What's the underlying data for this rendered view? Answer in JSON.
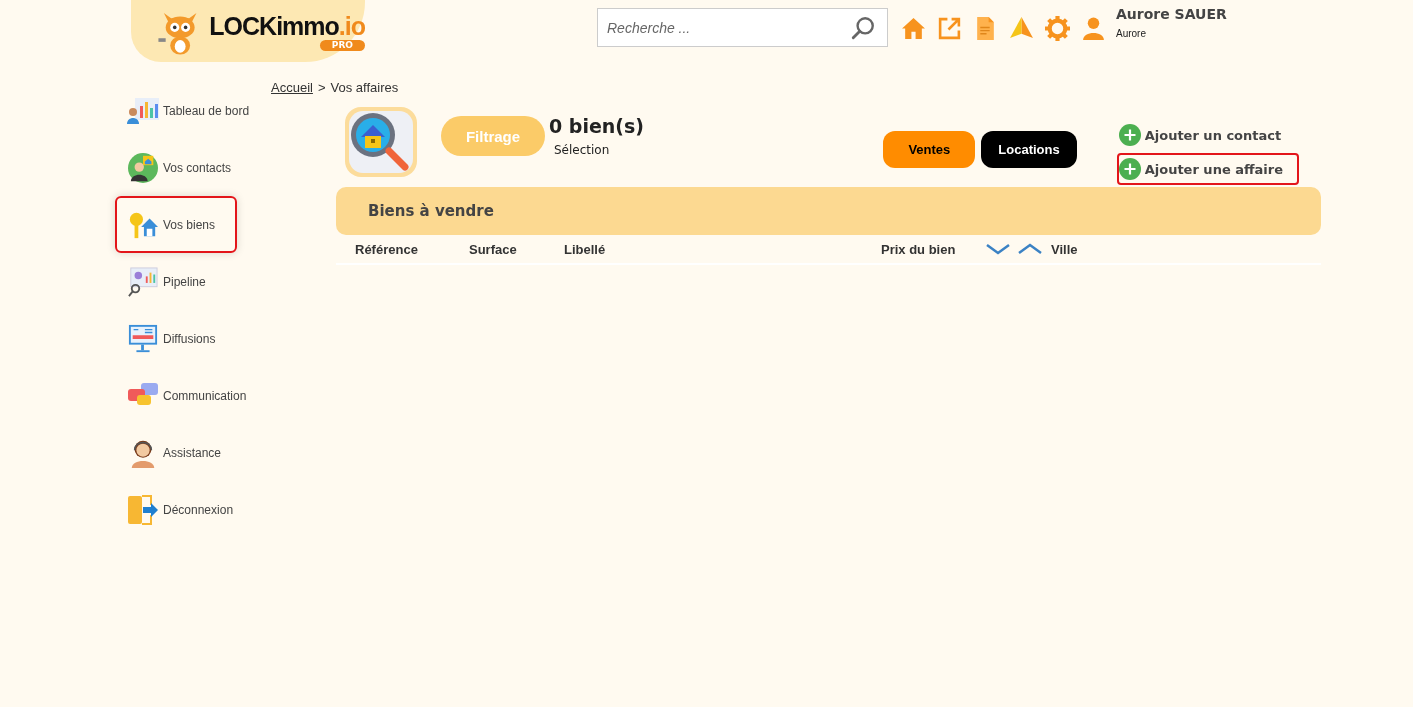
{
  "logo": {
    "name": "LOCKimmo",
    "suffix": ".io",
    "badge": "PRO"
  },
  "search": {
    "placeholder": "Recherche ..."
  },
  "user": {
    "name": "Aurore SAUER",
    "subtitle": "Aurore"
  },
  "sidebar": {
    "items": [
      {
        "label": "Tableau de bord",
        "kind": "dashboard",
        "selected": false
      },
      {
        "label": "Vos contacts",
        "kind": "contacts",
        "selected": false
      },
      {
        "label": "Vos biens",
        "kind": "properties",
        "selected": true
      },
      {
        "label": "Pipeline",
        "kind": "pipeline",
        "selected": false
      },
      {
        "label": "Diffusions",
        "kind": "diffusions",
        "selected": false
      },
      {
        "label": "Communication",
        "kind": "communication",
        "selected": false
      },
      {
        "label": "Assistance",
        "kind": "assistance",
        "selected": false
      },
      {
        "label": "Déconnexion",
        "kind": "logout",
        "selected": false
      }
    ]
  },
  "breadcrumb": [
    {
      "label": "Accueil",
      "kind": "link"
    },
    {
      "label": ">",
      "kind": "separator"
    },
    {
      "label": "Vos affaires",
      "kind": "current"
    }
  ],
  "filter_button": "Filtrage",
  "count": {
    "value": "0 bien(s)",
    "subtitle": "Sélection"
  },
  "tabs": [
    {
      "label": "Ventes",
      "selected": true
    },
    {
      "label": "Locations",
      "selected": false
    }
  ],
  "actions": [
    {
      "label": "Ajouter un contact",
      "highlighted": false
    },
    {
      "label": "Ajouter une affaire",
      "highlighted": true
    }
  ],
  "panel": {
    "title": "Biens à vendre"
  },
  "table": {
    "columns": [
      {
        "label": "Référence",
        "kind": "text"
      },
      {
        "label": "Surface",
        "kind": "text"
      },
      {
        "label": "Libellé",
        "kind": "text"
      },
      {
        "label": "Prix du bien",
        "kind": "sort"
      },
      {
        "label": "Ville",
        "kind": "text"
      }
    ]
  }
}
